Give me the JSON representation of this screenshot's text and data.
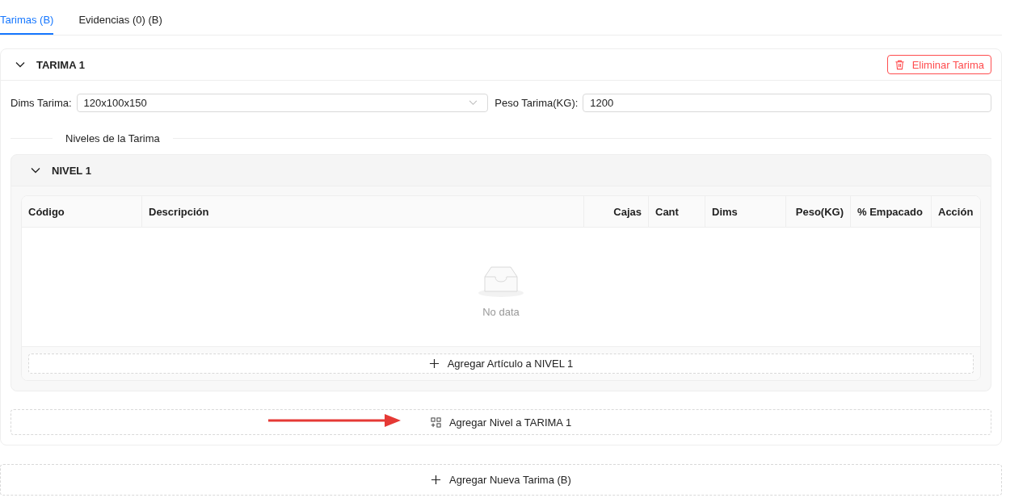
{
  "tabs": [
    {
      "label": "Tarimas (B)",
      "selected": true
    },
    {
      "label": "Evidencias (0) (B)",
      "selected": false
    }
  ],
  "tarima": {
    "title": "TARIMA 1",
    "expanded": true,
    "delete_button": "Eliminar Tarima",
    "dims_label": "Dims Tarima:",
    "dims_value": "120x100x150",
    "peso_label": "Peso Tarima(KG):",
    "peso_value": "1200",
    "divider_label": "Niveles de la Tarima",
    "nivel": {
      "title": "NIVEL 1",
      "expanded": true,
      "columns": [
        {
          "label": "Código"
        },
        {
          "label": "Descripción"
        },
        {
          "label": "Cajas"
        },
        {
          "label": "Cant"
        },
        {
          "label": "Dims"
        },
        {
          "label": "Peso(KG)"
        },
        {
          "label": "% Empacado"
        },
        {
          "label": "Acción"
        }
      ],
      "empty_text": "No data",
      "add_button": "Agregar Artículo a NIVEL 1"
    },
    "add_level_button": "Agregar Nivel a TARIMA 1"
  },
  "add_tarima_button": "Agregar Nueva Tarima (B)"
}
